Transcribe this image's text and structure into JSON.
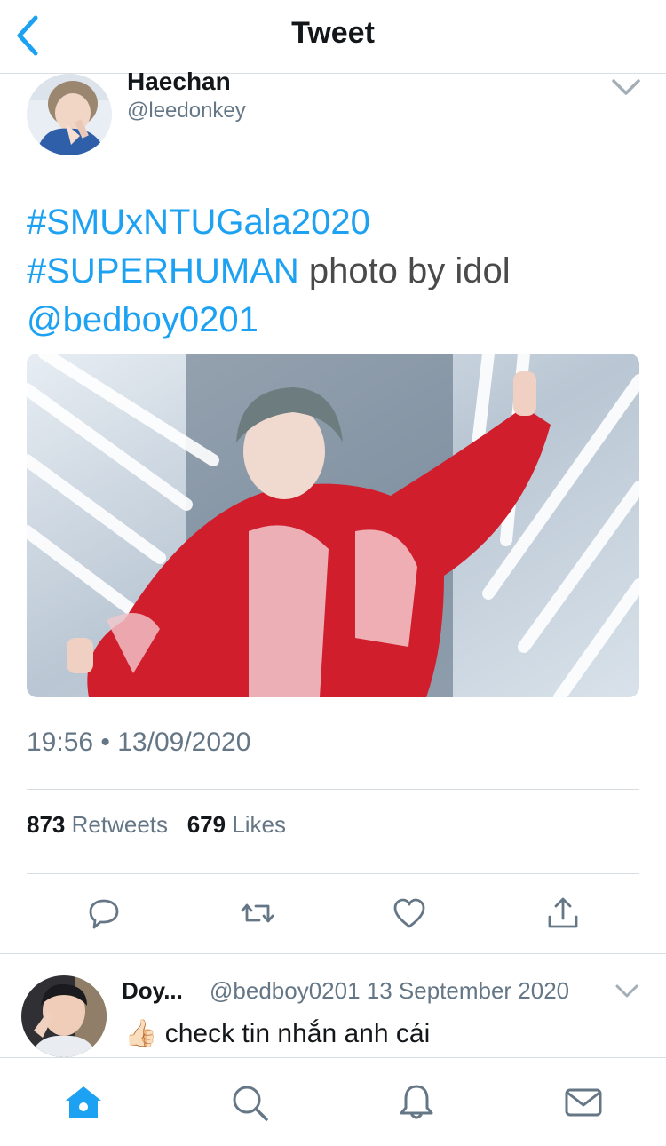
{
  "header": {
    "title": "Tweet",
    "back_icon": "chevron-left-icon"
  },
  "tweet": {
    "author_name": "Haechan",
    "author_handle": "@leedonkey",
    "text_parts": [
      {
        "text": "#SMUxNTUGala2020",
        "type": "hashtag"
      },
      {
        "text": "#SUPERHUMAN",
        "type": "hashtag"
      },
      {
        "text": " photo by idol",
        "type": "text"
      },
      {
        "text": "@bedboy0201",
        "type": "mention"
      }
    ],
    "timestamp": "19:56 • 13/09/2020",
    "retweets_count": "873",
    "retweets_label": "Retweets",
    "likes_count": "679",
    "likes_label": "Likes"
  },
  "actions": [
    "reply-icon",
    "retweet-icon",
    "like-icon",
    "share-icon"
  ],
  "reply": {
    "name": "Doy...",
    "meta": "@bedboy0201 13 September 2020",
    "emoji": "👍🏻",
    "text": "check tin nhắn anh cái"
  },
  "tabbar": [
    "home-icon",
    "search-icon",
    "notifications-icon",
    "messages-icon"
  ],
  "colors": {
    "accent": "#1da1f2",
    "text": "#14171a",
    "muted": "#657786",
    "divider": "#d8dde1"
  }
}
